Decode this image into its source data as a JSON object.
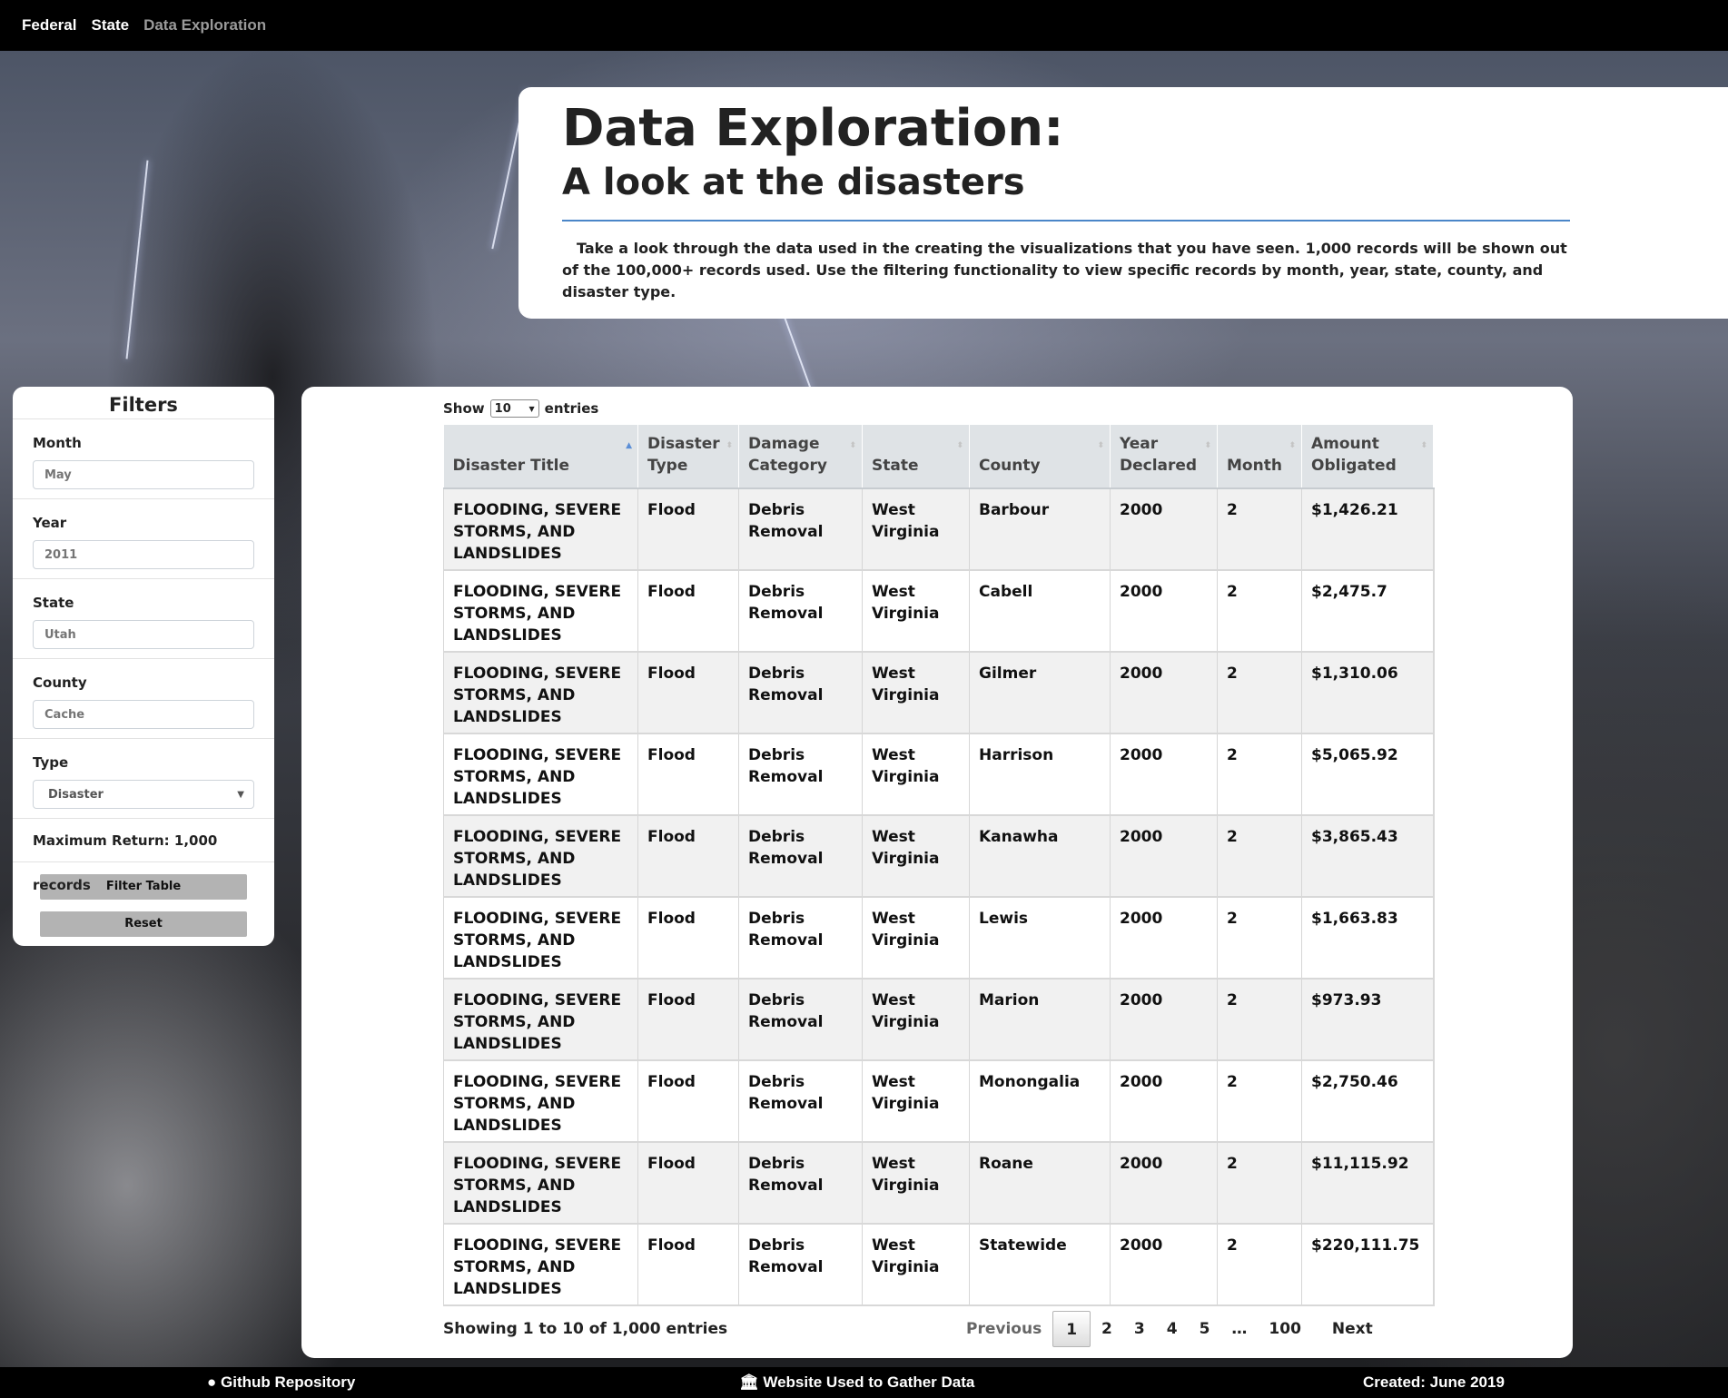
{
  "nav": {
    "items": [
      {
        "label": "Federal"
      },
      {
        "label": "State"
      },
      {
        "label": "Data Exploration"
      }
    ]
  },
  "header": {
    "title": "Data Exploration:",
    "subtitle": "A look at the disasters",
    "description": "Take a look through the data used in the creating the visualizations that you have seen. 1,000 records will be shown out of the 100,000+ records used. Use the filtering functionality to view specific records by month, year, state, county, and disaster type."
  },
  "filters": {
    "title": "Filters",
    "month": {
      "label": "Month",
      "placeholder": "May"
    },
    "year": {
      "label": "Year",
      "placeholder": "2011"
    },
    "state": {
      "label": "State",
      "placeholder": "Utah"
    },
    "county": {
      "label": "County",
      "placeholder": "Cache"
    },
    "type": {
      "label": "Type",
      "selected": "Disaster"
    },
    "max_return": "Maximum Return: 1,000 records",
    "filter_button": "Filter Table",
    "reset_button": "Reset"
  },
  "table": {
    "length": {
      "show": "Show",
      "value": "10",
      "entries": "entries"
    },
    "columns": [
      "Disaster Title",
      "Disaster Type",
      "Damage Category",
      "State",
      "County",
      "Year Declared",
      "Month",
      "Amount Obligated"
    ],
    "sorted_column": "Disaster Title",
    "rows": [
      [
        "FLOODING, SEVERE STORMS, AND LANDSLIDES",
        "Flood",
        "Debris Removal",
        "West Virginia",
        "Barbour",
        "2000",
        "2",
        "$1,426.21"
      ],
      [
        "FLOODING, SEVERE STORMS, AND LANDSLIDES",
        "Flood",
        "Debris Removal",
        "West Virginia",
        "Cabell",
        "2000",
        "2",
        "$2,475.7"
      ],
      [
        "FLOODING, SEVERE STORMS, AND LANDSLIDES",
        "Flood",
        "Debris Removal",
        "West Virginia",
        "Gilmer",
        "2000",
        "2",
        "$1,310.06"
      ],
      [
        "FLOODING, SEVERE STORMS, AND LANDSLIDES",
        "Flood",
        "Debris Removal",
        "West Virginia",
        "Harrison",
        "2000",
        "2",
        "$5,065.92"
      ],
      [
        "FLOODING, SEVERE STORMS, AND LANDSLIDES",
        "Flood",
        "Debris Removal",
        "West Virginia",
        "Kanawha",
        "2000",
        "2",
        "$3,865.43"
      ],
      [
        "FLOODING, SEVERE STORMS, AND LANDSLIDES",
        "Flood",
        "Debris Removal",
        "West Virginia",
        "Lewis",
        "2000",
        "2",
        "$1,663.83"
      ],
      [
        "FLOODING, SEVERE STORMS, AND LANDSLIDES",
        "Flood",
        "Debris Removal",
        "West Virginia",
        "Marion",
        "2000",
        "2",
        "$973.93"
      ],
      [
        "FLOODING, SEVERE STORMS, AND LANDSLIDES",
        "Flood",
        "Debris Removal",
        "West Virginia",
        "Monongalia",
        "2000",
        "2",
        "$2,750.46"
      ],
      [
        "FLOODING, SEVERE STORMS, AND LANDSLIDES",
        "Flood",
        "Debris Removal",
        "West Virginia",
        "Roane",
        "2000",
        "2",
        "$11,115.92"
      ],
      [
        "FLOODING, SEVERE STORMS, AND LANDSLIDES",
        "Flood",
        "Debris Removal",
        "West Virginia",
        "Statewide",
        "2000",
        "2",
        "$220,111.75"
      ]
    ],
    "info": "Showing 1 to 10 of 1,000 entries",
    "pagination": {
      "previous": "Previous",
      "pages": [
        "1",
        "2",
        "3",
        "4",
        "5",
        "…",
        "100"
      ],
      "current": "1",
      "next": "Next"
    }
  },
  "footer": {
    "github": "Github Repository",
    "website": "Website Used to Gather Data",
    "created": "Created: June 2019"
  },
  "icons": {
    "github": "github-icon",
    "website": "bank-icon",
    "sort_asc": "sort-ascending-icon",
    "sort": "sort-icon",
    "dropdown": "chevron-down-icon"
  },
  "colors": {
    "navbar": "#000000",
    "accent_rule": "#4a86c8",
    "table_header": "#dfe3e6",
    "button": "#b3b3b3"
  }
}
